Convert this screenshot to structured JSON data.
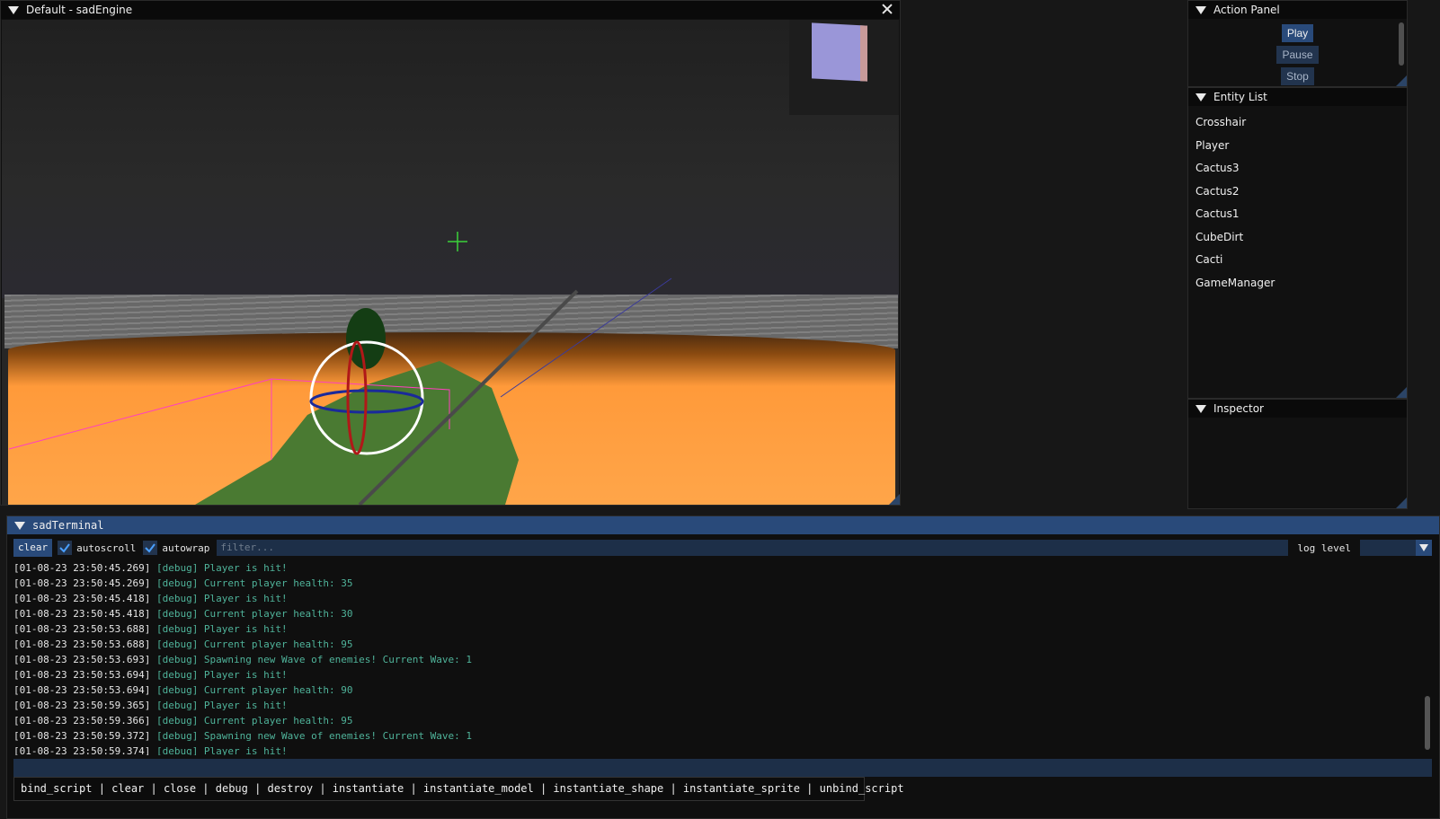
{
  "viewport": {
    "title": "Default - sadEngine"
  },
  "action_panel": {
    "title": "Action Panel",
    "buttons": [
      "Play",
      "Pause",
      "Stop"
    ]
  },
  "entity_list": {
    "title": "Entity List",
    "items": [
      "Crosshair",
      "Player",
      "Cactus3",
      "Cactus2",
      "Cactus1",
      "CubeDirt",
      "Cacti",
      "GameManager"
    ]
  },
  "inspector": {
    "title": "Inspector"
  },
  "terminal": {
    "title": "sadTerminal",
    "clear_label": "clear",
    "autoscroll_label": "autoscroll",
    "autowrap_label": "autowrap",
    "filter_placeholder": "filter...",
    "log_level_label": "log level",
    "log_level_value": "",
    "lines": [
      {
        "ts": "[01-08-23 23:50:45.269]",
        "msg": "[debug] Player is hit!"
      },
      {
        "ts": "[01-08-23 23:50:45.269]",
        "msg": "[debug] Current player health: 35"
      },
      {
        "ts": "[01-08-23 23:50:45.418]",
        "msg": "[debug] Player is hit!"
      },
      {
        "ts": "[01-08-23 23:50:45.418]",
        "msg": "[debug] Current player health: 30"
      },
      {
        "ts": "[01-08-23 23:50:53.688]",
        "msg": "[debug] Player is hit!"
      },
      {
        "ts": "[01-08-23 23:50:53.688]",
        "msg": "[debug] Current player health: 95"
      },
      {
        "ts": "[01-08-23 23:50:53.693]",
        "msg": "[debug] Spawning new Wave of enemies! Current Wave: 1"
      },
      {
        "ts": "[01-08-23 23:50:53.694]",
        "msg": "[debug] Player is hit!"
      },
      {
        "ts": "[01-08-23 23:50:53.694]",
        "msg": "[debug] Current player health: 90"
      },
      {
        "ts": "[01-08-23 23:50:59.365]",
        "msg": "[debug] Player is hit!"
      },
      {
        "ts": "[01-08-23 23:50:59.366]",
        "msg": "[debug] Current player health: 95"
      },
      {
        "ts": "[01-08-23 23:50:59.372]",
        "msg": "[debug] Spawning new Wave of enemies! Current Wave: 1"
      },
      {
        "ts": "[01-08-23 23:50:59.374]",
        "msg": "[debug] Player is hit!"
      }
    ],
    "command_input_value": "",
    "suggestions": "bind_script | clear | close | debug | destroy | instantiate | instantiate_model | instantiate_shape | instantiate_sprite | unbind_script"
  },
  "colors": {
    "accent": "#294a7a",
    "log_text": "#4fb39a",
    "ground": "#ffa64a",
    "cactus": "#4a7a32"
  }
}
